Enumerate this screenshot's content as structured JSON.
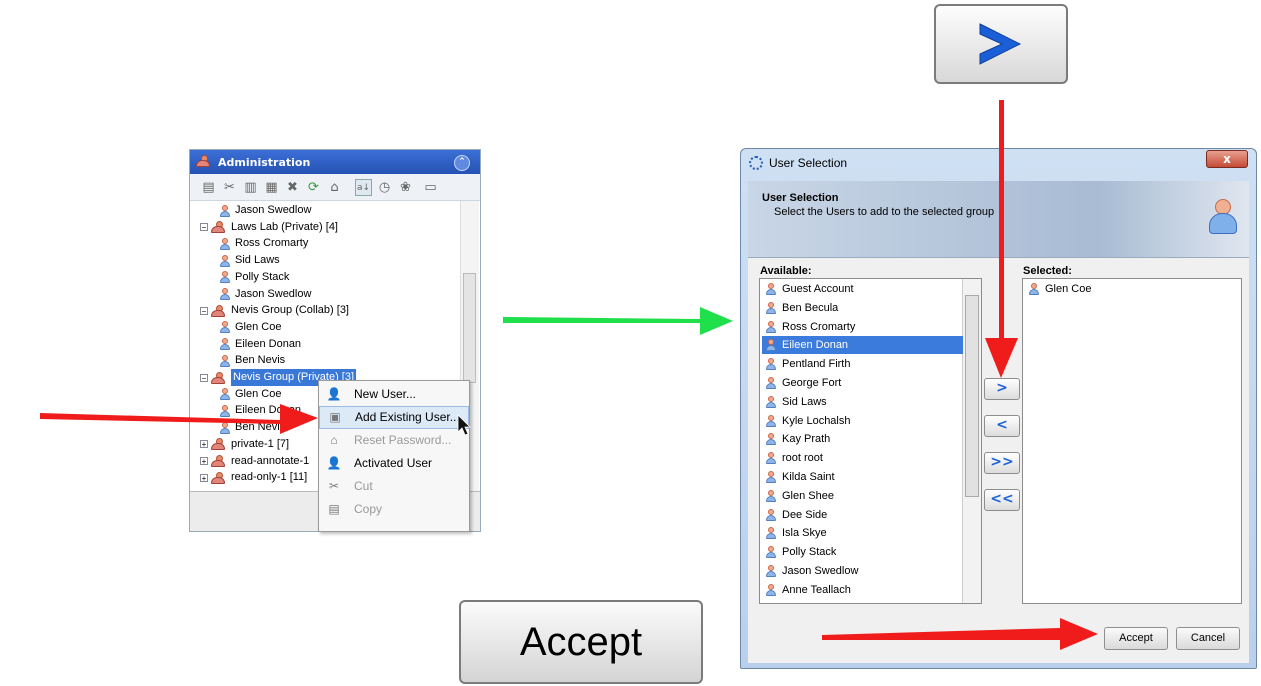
{
  "admin": {
    "title": "Administration",
    "tree": [
      {
        "label": "Jason Swedlow",
        "kind": "user"
      },
      {
        "label": "Laws Lab (Private) [4]",
        "kind": "group"
      },
      {
        "label": "Ross Cromarty",
        "kind": "user"
      },
      {
        "label": "Sid Laws",
        "kind": "user"
      },
      {
        "label": "Polly Stack",
        "kind": "user"
      },
      {
        "label": "Jason Swedlow",
        "kind": "user"
      },
      {
        "label": "Nevis Group (Collab) [3]",
        "kind": "group"
      },
      {
        "label": "Glen Coe",
        "kind": "user"
      },
      {
        "label": "Eileen Donan",
        "kind": "user"
      },
      {
        "label": "Ben Nevis",
        "kind": "user"
      },
      {
        "label": "Nevis Group (Private) [3]",
        "kind": "group",
        "selected": true
      },
      {
        "label": "Glen Coe",
        "kind": "user"
      },
      {
        "label": "Eileen Donan",
        "kind": "user"
      },
      {
        "label": "Ben Nevis",
        "kind": "user"
      },
      {
        "label": "private-1 [7]",
        "kind": "group"
      },
      {
        "label": "read-annotate-1",
        "kind": "group"
      },
      {
        "label": "read-only-1 [11]",
        "kind": "group"
      }
    ]
  },
  "context_menu": {
    "items": [
      {
        "label": "New User...",
        "icon": "user-icon",
        "enabled": true
      },
      {
        "label": "Add Existing User...",
        "icon": "add-user-icon",
        "enabled": true,
        "hover": true
      },
      {
        "label": "Reset Password...",
        "icon": "home-icon",
        "enabled": false
      },
      {
        "label": "Activated User",
        "icon": "user-icon",
        "enabled": true
      },
      {
        "label": "Cut",
        "icon": "scissors-icon",
        "enabled": false
      },
      {
        "label": "Copy",
        "icon": "copy-icon",
        "enabled": false
      }
    ]
  },
  "dialog": {
    "title": "User Selection",
    "close_label": "x",
    "banner_title": "User Selection",
    "banner_subtitle": "Select the Users to add to the selected group",
    "available_label": "Available:",
    "selected_label": "Selected:",
    "available": [
      "Guest Account",
      "Ben Becula",
      "Ross Cromarty",
      "Eileen Donan",
      "Pentland Firth",
      "George Fort",
      "Sid Laws",
      "Kyle Lochalsh",
      "Kay Prath",
      "root root",
      "Kilda Saint",
      "Glen Shee",
      "Dee Side",
      "Isla Skye",
      "Polly Stack",
      "Jason Swedlow",
      "Anne Teallach"
    ],
    "available_selected_index": 3,
    "selected": [
      "Glen Coe"
    ],
    "move_buttons": [
      ">",
      "<",
      ">>",
      "<<"
    ],
    "accept_label": "Accept",
    "cancel_label": "Cancel"
  },
  "zoom": {
    "next_symbol": ">",
    "accept_label": "Accept"
  },
  "colors": {
    "arrow_red": "#f01c1c",
    "arrow_green": "#1fe04a",
    "selection_blue": "#3b7bdc"
  }
}
